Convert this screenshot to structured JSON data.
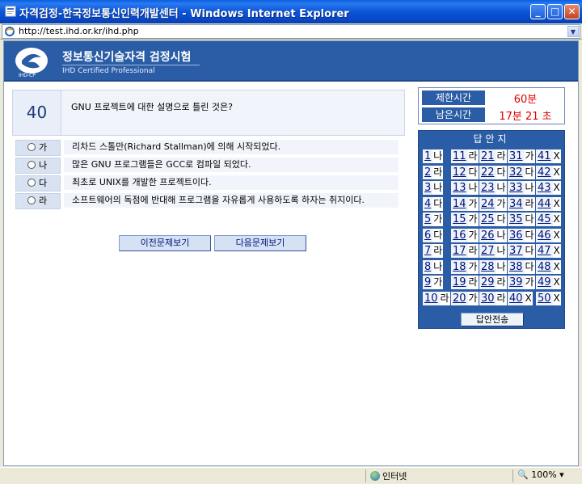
{
  "window": {
    "title": "자격검정-한국정보통신인력개발센터 - Windows Internet Explorer",
    "url": "http://test.ihd.or.kr/ihd.php"
  },
  "banner": {
    "logo_text": "IHD-CP",
    "title": "정보통신기술자격 검정시험",
    "subtitle": "IHD Certified Professional"
  },
  "question": {
    "number": "40",
    "text": "GNU 프로젝트에 대한 설명으로 틀린 것은?",
    "options": [
      {
        "label": "가",
        "text": "리차드 스톨만(Richard Stallman)에 의해 시작되었다."
      },
      {
        "label": "나",
        "text": "많은 GNU 프로그램들은 GCC로 컴파일 되었다."
      },
      {
        "label": "다",
        "text": "최초로 UNIX를 개발한 프로젝트이다."
      },
      {
        "label": "라",
        "text": "소프트웨어의 독점에 반대해 프로그램을 자유롭게 사용하도록 하자는 취지이다."
      }
    ]
  },
  "nav": {
    "prev": "이전문제보기",
    "next": "다음문제보기"
  },
  "timer": {
    "limit_label": "제한시간",
    "limit_value": "60분",
    "remain_label": "남은시간",
    "remain_value": "17분 21 초"
  },
  "answer_sheet": {
    "title": "답안지",
    "submit": "답안전송",
    "rows": [
      [
        [
          "1",
          "나"
        ],
        [
          "11",
          "라"
        ],
        [
          "21",
          "라"
        ],
        [
          "31",
          "가"
        ],
        [
          "41",
          "X"
        ]
      ],
      [
        [
          "2",
          "라"
        ],
        [
          "12",
          "다"
        ],
        [
          "22",
          "다"
        ],
        [
          "32",
          "다"
        ],
        [
          "42",
          "X"
        ]
      ],
      [
        [
          "3",
          "나"
        ],
        [
          "13",
          "나"
        ],
        [
          "23",
          "나"
        ],
        [
          "33",
          "나"
        ],
        [
          "43",
          "X"
        ]
      ],
      [
        [
          "4",
          "다"
        ],
        [
          "14",
          "가"
        ],
        [
          "24",
          "가"
        ],
        [
          "34",
          "라"
        ],
        [
          "44",
          "X"
        ]
      ],
      [
        [
          "5",
          "가"
        ],
        [
          "15",
          "가"
        ],
        [
          "25",
          "다"
        ],
        [
          "35",
          "다"
        ],
        [
          "45",
          "X"
        ]
      ],
      [
        [
          "6",
          "다"
        ],
        [
          "16",
          "가"
        ],
        [
          "26",
          "나"
        ],
        [
          "36",
          "다"
        ],
        [
          "46",
          "X"
        ]
      ],
      [
        [
          "7",
          "라"
        ],
        [
          "17",
          "라"
        ],
        [
          "27",
          "나"
        ],
        [
          "37",
          "다"
        ],
        [
          "47",
          "X"
        ]
      ],
      [
        [
          "8",
          "나"
        ],
        [
          "18",
          "가"
        ],
        [
          "28",
          "나"
        ],
        [
          "38",
          "다"
        ],
        [
          "48",
          "X"
        ]
      ],
      [
        [
          "9",
          "가"
        ],
        [
          "19",
          "라"
        ],
        [
          "29",
          "라"
        ],
        [
          "39",
          "가"
        ],
        [
          "49",
          "X"
        ]
      ],
      [
        [
          "10",
          "라"
        ],
        [
          "20",
          "가"
        ],
        [
          "30",
          "라"
        ],
        [
          "40",
          "X"
        ],
        [
          "50",
          "X"
        ]
      ]
    ]
  },
  "status": {
    "zone": "인터넷",
    "zoom": "100%"
  }
}
